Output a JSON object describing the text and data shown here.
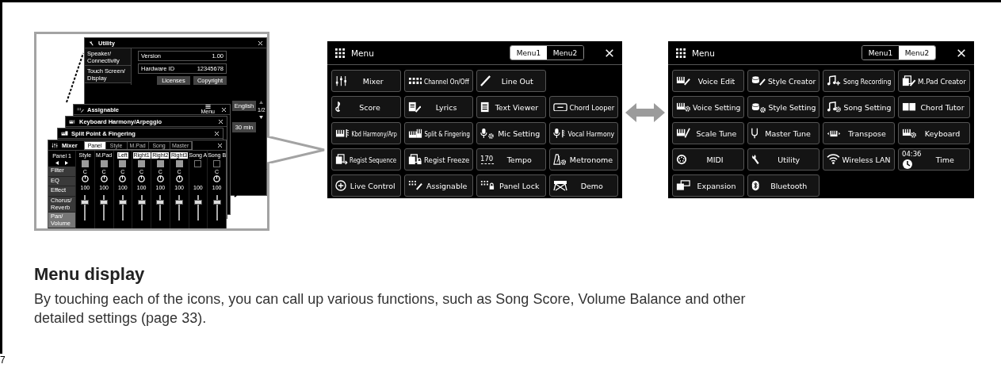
{
  "detail_inset": {
    "utility": {
      "title": "Utility",
      "sidebar": [
        "Speaker/ Connectivity",
        "Touch Screen/ Display"
      ],
      "rows": [
        {
          "label": "Version",
          "value": "1.00"
        },
        {
          "label": "Hardware ID",
          "value": "12345678"
        }
      ],
      "buttons": [
        "Licenses",
        "Copyright"
      ],
      "side_buttons": [
        "English",
        "30 min"
      ],
      "page": "1/2"
    },
    "stacked_windows": [
      {
        "title": "Assignable",
        "menu_label": "Menu"
      },
      {
        "title": "Keyboard Harmony/Arpeggio"
      },
      {
        "title": "Split Point & Fingering"
      }
    ],
    "mixer": {
      "title": "Mixer",
      "tabs": [
        {
          "label": "Panel",
          "selected": true
        },
        {
          "label": "Style",
          "selected": false
        },
        {
          "label": "M.Pad",
          "selected": false
        },
        {
          "label": "Song",
          "selected": false
        },
        {
          "label": "Master",
          "selected": false
        }
      ],
      "panel": "Panel 1",
      "sections": [
        {
          "label": "Filter",
          "selected": false
        },
        {
          "label": "EQ",
          "selected": false
        },
        {
          "label": "Effect",
          "selected": false
        },
        {
          "label": "Chorus/ Reverb",
          "selected": false
        },
        {
          "label": "Pan/ Volume",
          "selected": true
        }
      ],
      "channels": [
        {
          "name": "Style",
          "on": false,
          "kind": "part",
          "pan": "C",
          "volume": "100",
          "level": 0.72
        },
        {
          "name": "M.Pad",
          "on": false,
          "kind": "part",
          "pan": "C",
          "volume": "100",
          "level": 0.72
        },
        {
          "name": "Left",
          "on": true,
          "kind": "part",
          "pan": "C",
          "volume": "100",
          "level": 0.72
        },
        {
          "name": "Right1",
          "on": true,
          "kind": "part",
          "pan": "C",
          "volume": "100",
          "level": 0.72
        },
        {
          "name": "Right2",
          "on": true,
          "kind": "part",
          "pan": "C",
          "volume": "100",
          "level": 0.72
        },
        {
          "name": "Right3",
          "on": true,
          "kind": "part",
          "pan": "C",
          "volume": "100",
          "level": 0.72
        },
        {
          "name": "Song A",
          "on": false,
          "kind": "song",
          "volume": "100",
          "level": 0.72
        },
        {
          "name": "Song B",
          "on": false,
          "kind": "song",
          "pan": "C",
          "volume": "100",
          "level": 0.72
        }
      ]
    }
  },
  "menu_screens": [
    {
      "title": "Menu",
      "tabs": [
        {
          "label": "Menu1",
          "selected": true
        },
        {
          "label": "Menu2",
          "selected": false
        }
      ],
      "rows": [
        [
          {
            "label": "Mixer"
          },
          {
            "label": "Channel On/Off"
          },
          {
            "label": "Line Out"
          }
        ],
        [
          {
            "label": "Score"
          },
          {
            "label": "Lyrics"
          },
          {
            "label": "Text Viewer"
          },
          {
            "label": "Chord Looper"
          }
        ],
        [
          {
            "label": "Kbd Harmony/Arp"
          },
          {
            "label": "Split & Fingering"
          },
          {
            "label": "Mic Setting"
          },
          {
            "label": "Vocal Harmony"
          }
        ],
        [
          {
            "label": "Regist Sequence"
          },
          {
            "label": "Regist Freeze"
          },
          {
            "label": "Tempo",
            "sub": "170"
          },
          {
            "label": "Metronome"
          }
        ],
        [
          {
            "label": "Live Control"
          },
          {
            "label": "Assignable"
          },
          {
            "label": "Panel Lock"
          },
          {
            "label": "Demo"
          }
        ]
      ]
    },
    {
      "title": "Menu",
      "tabs": [
        {
          "label": "Menu1",
          "selected": false
        },
        {
          "label": "Menu2",
          "selected": true
        }
      ],
      "rows": [
        [
          {
            "label": "Voice Edit"
          },
          {
            "label": "Style Creator"
          },
          {
            "label": "Song Recording"
          },
          {
            "label": "M.Pad Creator"
          }
        ],
        [
          {
            "label": "Voice Setting"
          },
          {
            "label": "Style Setting"
          },
          {
            "label": "Song Setting"
          },
          {
            "label": "Chord Tutor"
          }
        ],
        [
          {
            "label": "Scale Tune"
          },
          {
            "label": "Master Tune"
          },
          {
            "label": "Transpose"
          },
          {
            "label": "Keyboard"
          }
        ],
        [
          {
            "label": "MIDI"
          },
          {
            "label": "Utility"
          },
          {
            "label": "Wireless LAN"
          },
          {
            "label": "Time",
            "sub": "04:36"
          }
        ],
        [
          {
            "label": "Expansion"
          },
          {
            "label": "Bluetooth"
          }
        ]
      ]
    }
  ],
  "heading": "Menu display",
  "description": "By touching each of the icons, you can call up various functions, such as Song Score, Volume Balance and other detailed settings (page 33).",
  "page_number": "7"
}
